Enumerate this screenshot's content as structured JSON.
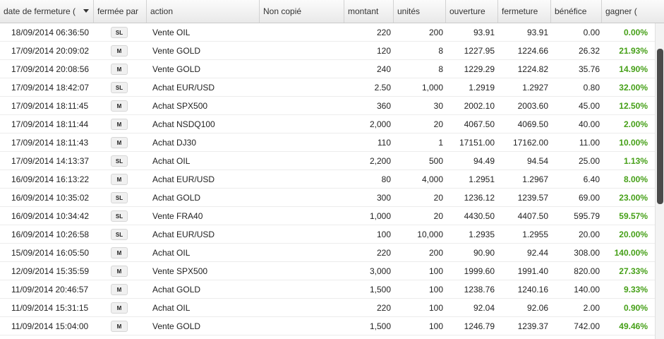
{
  "table": {
    "columns": [
      {
        "label": "date de fermeture (",
        "name": "col-date"
      },
      {
        "label": "fermée par",
        "name": "col-closed-by"
      },
      {
        "label": "action",
        "name": "col-action"
      },
      {
        "label": "Non copié",
        "name": "col-not-copied"
      },
      {
        "label": "montant",
        "name": "col-amount"
      },
      {
        "label": "unités",
        "name": "col-units"
      },
      {
        "label": "ouverture",
        "name": "col-open"
      },
      {
        "label": "fermeture",
        "name": "col-close"
      },
      {
        "label": "bénéfice",
        "name": "col-profit"
      },
      {
        "label": "gagner (",
        "name": "col-gain"
      }
    ],
    "sort_icon": "chevron-down-icon",
    "rows": [
      {
        "date": "18/09/2014 06:36:50",
        "closed_by": "SL",
        "action": "Vente OIL",
        "amount": "220",
        "units": "200",
        "open": "93.91",
        "close": "93.91",
        "profit": "0.00",
        "gain": "0.00%"
      },
      {
        "date": "17/09/2014 20:09:02",
        "closed_by": "M",
        "action": "Vente GOLD",
        "amount": "120",
        "units": "8",
        "open": "1227.95",
        "close": "1224.66",
        "profit": "26.32",
        "gain": "21.93%"
      },
      {
        "date": "17/09/2014 20:08:56",
        "closed_by": "M",
        "action": "Vente GOLD",
        "amount": "240",
        "units": "8",
        "open": "1229.29",
        "close": "1224.82",
        "profit": "35.76",
        "gain": "14.90%"
      },
      {
        "date": "17/09/2014 18:42:07",
        "closed_by": "SL",
        "action": "Achat EUR/USD",
        "amount": "2.50",
        "units": "1,000",
        "open": "1.2919",
        "close": "1.2927",
        "profit": "0.80",
        "gain": "32.00%"
      },
      {
        "date": "17/09/2014 18:11:45",
        "closed_by": "M",
        "action": "Achat SPX500",
        "amount": "360",
        "units": "30",
        "open": "2002.10",
        "close": "2003.60",
        "profit": "45.00",
        "gain": "12.50%"
      },
      {
        "date": "17/09/2014 18:11:44",
        "closed_by": "M",
        "action": "Achat NSDQ100",
        "amount": "2,000",
        "units": "20",
        "open": "4067.50",
        "close": "4069.50",
        "profit": "40.00",
        "gain": "2.00%"
      },
      {
        "date": "17/09/2014 18:11:43",
        "closed_by": "M",
        "action": "Achat DJ30",
        "amount": "110",
        "units": "1",
        "open": "17151.00",
        "close": "17162.00",
        "profit": "11.00",
        "gain": "10.00%"
      },
      {
        "date": "17/09/2014 14:13:37",
        "closed_by": "SL",
        "action": "Achat OIL",
        "amount": "2,200",
        "units": "500",
        "open": "94.49",
        "close": "94.54",
        "profit": "25.00",
        "gain": "1.13%"
      },
      {
        "date": "16/09/2014 16:13:22",
        "closed_by": "M",
        "action": "Achat EUR/USD",
        "amount": "80",
        "units": "4,000",
        "open": "1.2951",
        "close": "1.2967",
        "profit": "6.40",
        "gain": "8.00%"
      },
      {
        "date": "16/09/2014 10:35:02",
        "closed_by": "SL",
        "action": "Achat GOLD",
        "amount": "300",
        "units": "20",
        "open": "1236.12",
        "close": "1239.57",
        "profit": "69.00",
        "gain": "23.00%"
      },
      {
        "date": "16/09/2014 10:34:42",
        "closed_by": "SL",
        "action": "Vente FRA40",
        "amount": "1,000",
        "units": "20",
        "open": "4430.50",
        "close": "4407.50",
        "profit": "595.79",
        "gain": "59.57%"
      },
      {
        "date": "16/09/2014 10:26:58",
        "closed_by": "SL",
        "action": "Achat EUR/USD",
        "amount": "100",
        "units": "10,000",
        "open": "1.2935",
        "close": "1.2955",
        "profit": "20.00",
        "gain": "20.00%"
      },
      {
        "date": "15/09/2014 16:05:50",
        "closed_by": "M",
        "action": "Achat OIL",
        "amount": "220",
        "units": "200",
        "open": "90.90",
        "close": "92.44",
        "profit": "308.00",
        "gain": "140.00%"
      },
      {
        "date": "12/09/2014 15:35:59",
        "closed_by": "M",
        "action": "Vente SPX500",
        "amount": "3,000",
        "units": "100",
        "open": "1999.60",
        "close": "1991.40",
        "profit": "820.00",
        "gain": "27.33%"
      },
      {
        "date": "11/09/2014 20:46:57",
        "closed_by": "M",
        "action": "Achat GOLD",
        "amount": "1,500",
        "units": "100",
        "open": "1238.76",
        "close": "1240.16",
        "profit": "140.00",
        "gain": "9.33%"
      },
      {
        "date": "11/09/2014 15:31:15",
        "closed_by": "M",
        "action": "Achat OIL",
        "amount": "220",
        "units": "100",
        "open": "92.04",
        "close": "92.06",
        "profit": "2.00",
        "gain": "0.90%"
      },
      {
        "date": "11/09/2014 15:04:00",
        "closed_by": "M",
        "action": "Vente GOLD",
        "amount": "1,500",
        "units": "100",
        "open": "1246.79",
        "close": "1239.37",
        "profit": "742.00",
        "gain": "49.46%"
      }
    ]
  },
  "colors": {
    "gain_green": "#46a018",
    "scroll_thumb": "#4a4a4a"
  }
}
